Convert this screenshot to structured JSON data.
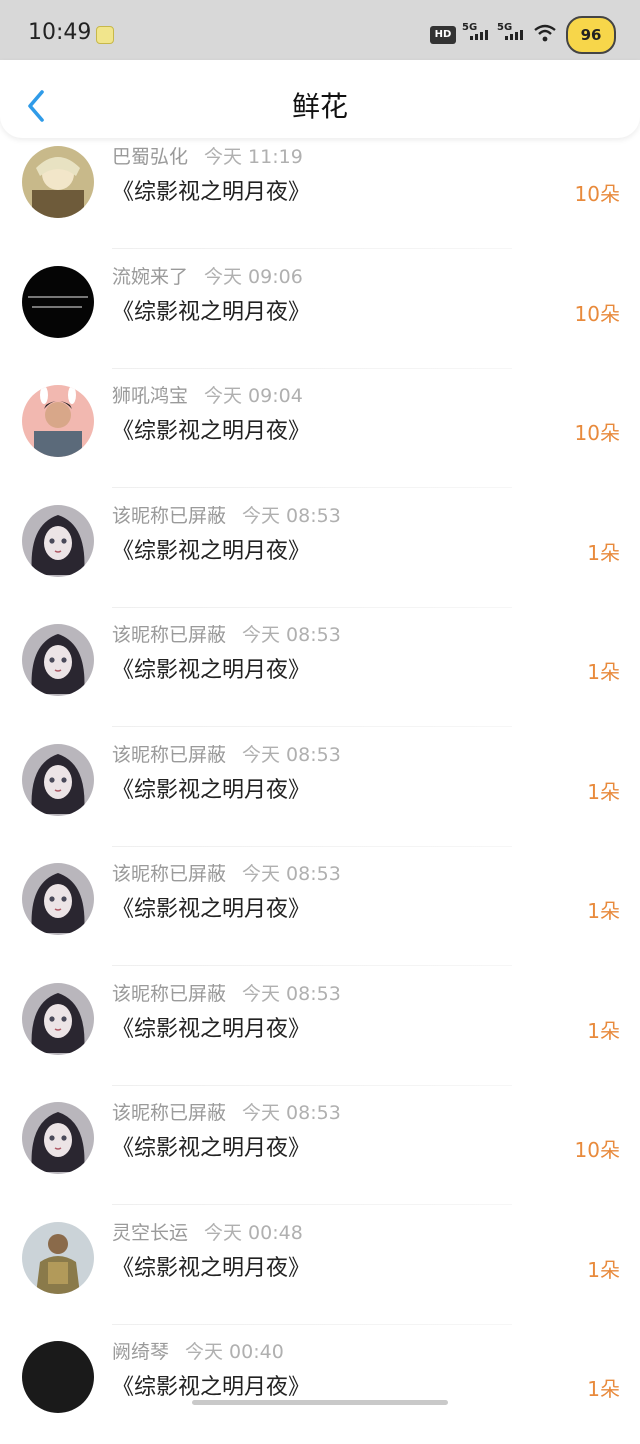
{
  "status_bar": {
    "time": "10:49",
    "hd_label": "HD",
    "signal1": "5G",
    "signal2": "5G",
    "battery": "96"
  },
  "header": {
    "title": "鲜花",
    "back_icon": "chevron-left-icon"
  },
  "colors": {
    "accent": "#2f9be8",
    "amount": "#e88a3c",
    "name_gray": "#9a9a9a"
  },
  "rows": [
    {
      "name": "巴蜀弘化",
      "time": "今天 11:19",
      "book": "《综影视之明月夜》",
      "amount": "10朵",
      "avatar": "anime-boy"
    },
    {
      "name": "流婉来了",
      "time": "今天 09:06",
      "book": "《综影视之明月夜》",
      "amount": "10朵",
      "avatar": "black-text"
    },
    {
      "name": "狮吼鸿宝",
      "time": "今天 09:04",
      "book": "《综影视之明月夜》",
      "amount": "10朵",
      "avatar": "photo-man"
    },
    {
      "name": "该昵称已屏蔽",
      "time": "今天 08:53",
      "book": "《综影视之明月夜》",
      "amount": "1朵",
      "avatar": "anime-girl"
    },
    {
      "name": "该昵称已屏蔽",
      "time": "今天 08:53",
      "book": "《综影视之明月夜》",
      "amount": "1朵",
      "avatar": "anime-girl"
    },
    {
      "name": "该昵称已屏蔽",
      "time": "今天 08:53",
      "book": "《综影视之明月夜》",
      "amount": "1朵",
      "avatar": "anime-girl"
    },
    {
      "name": "该昵称已屏蔽",
      "time": "今天 08:53",
      "book": "《综影视之明月夜》",
      "amount": "1朵",
      "avatar": "anime-girl"
    },
    {
      "name": "该昵称已屏蔽",
      "time": "今天 08:53",
      "book": "《综影视之明月夜》",
      "amount": "1朵",
      "avatar": "anime-girl"
    },
    {
      "name": "该昵称已屏蔽",
      "time": "今天 08:53",
      "book": "《综影视之明月夜》",
      "amount": "10朵",
      "avatar": "anime-girl"
    },
    {
      "name": "灵空长运",
      "time": "今天 00:48",
      "book": "《综影视之明月夜》",
      "amount": "1朵",
      "avatar": "armored-warrior"
    },
    {
      "name": "阙绮琴",
      "time": "今天 00:40",
      "book": "《综影视之明月夜》",
      "amount": "1朵",
      "avatar": "black-circle"
    }
  ]
}
